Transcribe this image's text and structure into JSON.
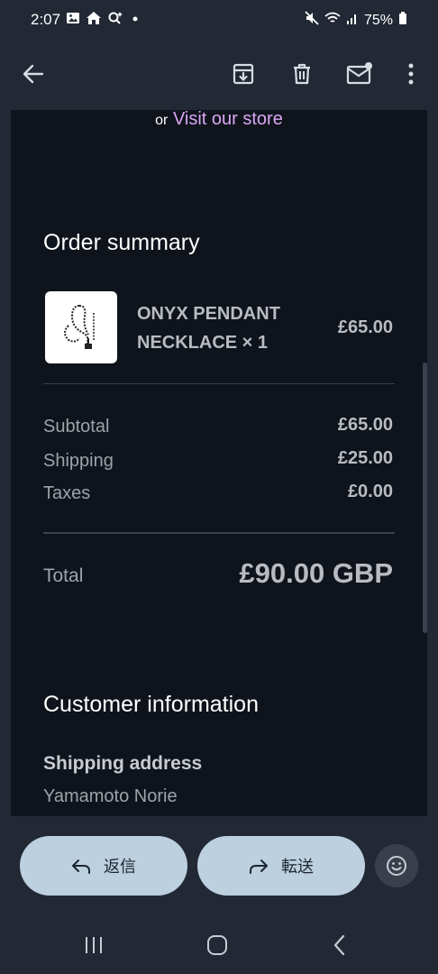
{
  "status": {
    "time": "2:07",
    "battery": "75%",
    "left_icons": [
      "image-icon",
      "home-icon",
      "search-sparkle-icon",
      "dot-icon"
    ],
    "right_icons": [
      "mute-icon",
      "wifi-icon",
      "signal-icon",
      "battery-icon"
    ]
  },
  "toolbar": {
    "icons": [
      "back-arrow-icon",
      "archive-icon",
      "delete-icon",
      "mark-unread-icon",
      "more-options-icon"
    ]
  },
  "email": {
    "store_prefix": "or",
    "store_link": "Visit our store",
    "order_summary_title": "Order summary",
    "product": {
      "name": "ONYX PENDANT NECKLACE × 1",
      "price": "£65.00"
    },
    "rows": [
      {
        "label": "Subtotal",
        "value": "£65.00"
      },
      {
        "label": "Shipping",
        "value": "£25.00"
      },
      {
        "label": "Taxes",
        "value": "£0.00"
      }
    ],
    "total_label": "Total",
    "total_value": "£90.00 GBP",
    "customer_info_title": "Customer information",
    "shipping_address_label": "Shipping address",
    "shipping_name": "Yamamoto Norie"
  },
  "actions": {
    "reply_label": "返信",
    "forward_label": "転送"
  },
  "colors": {
    "background": "#222834",
    "email_background": "#0f141c",
    "link": "#d9a6f5",
    "pill": "#bcd0df"
  }
}
